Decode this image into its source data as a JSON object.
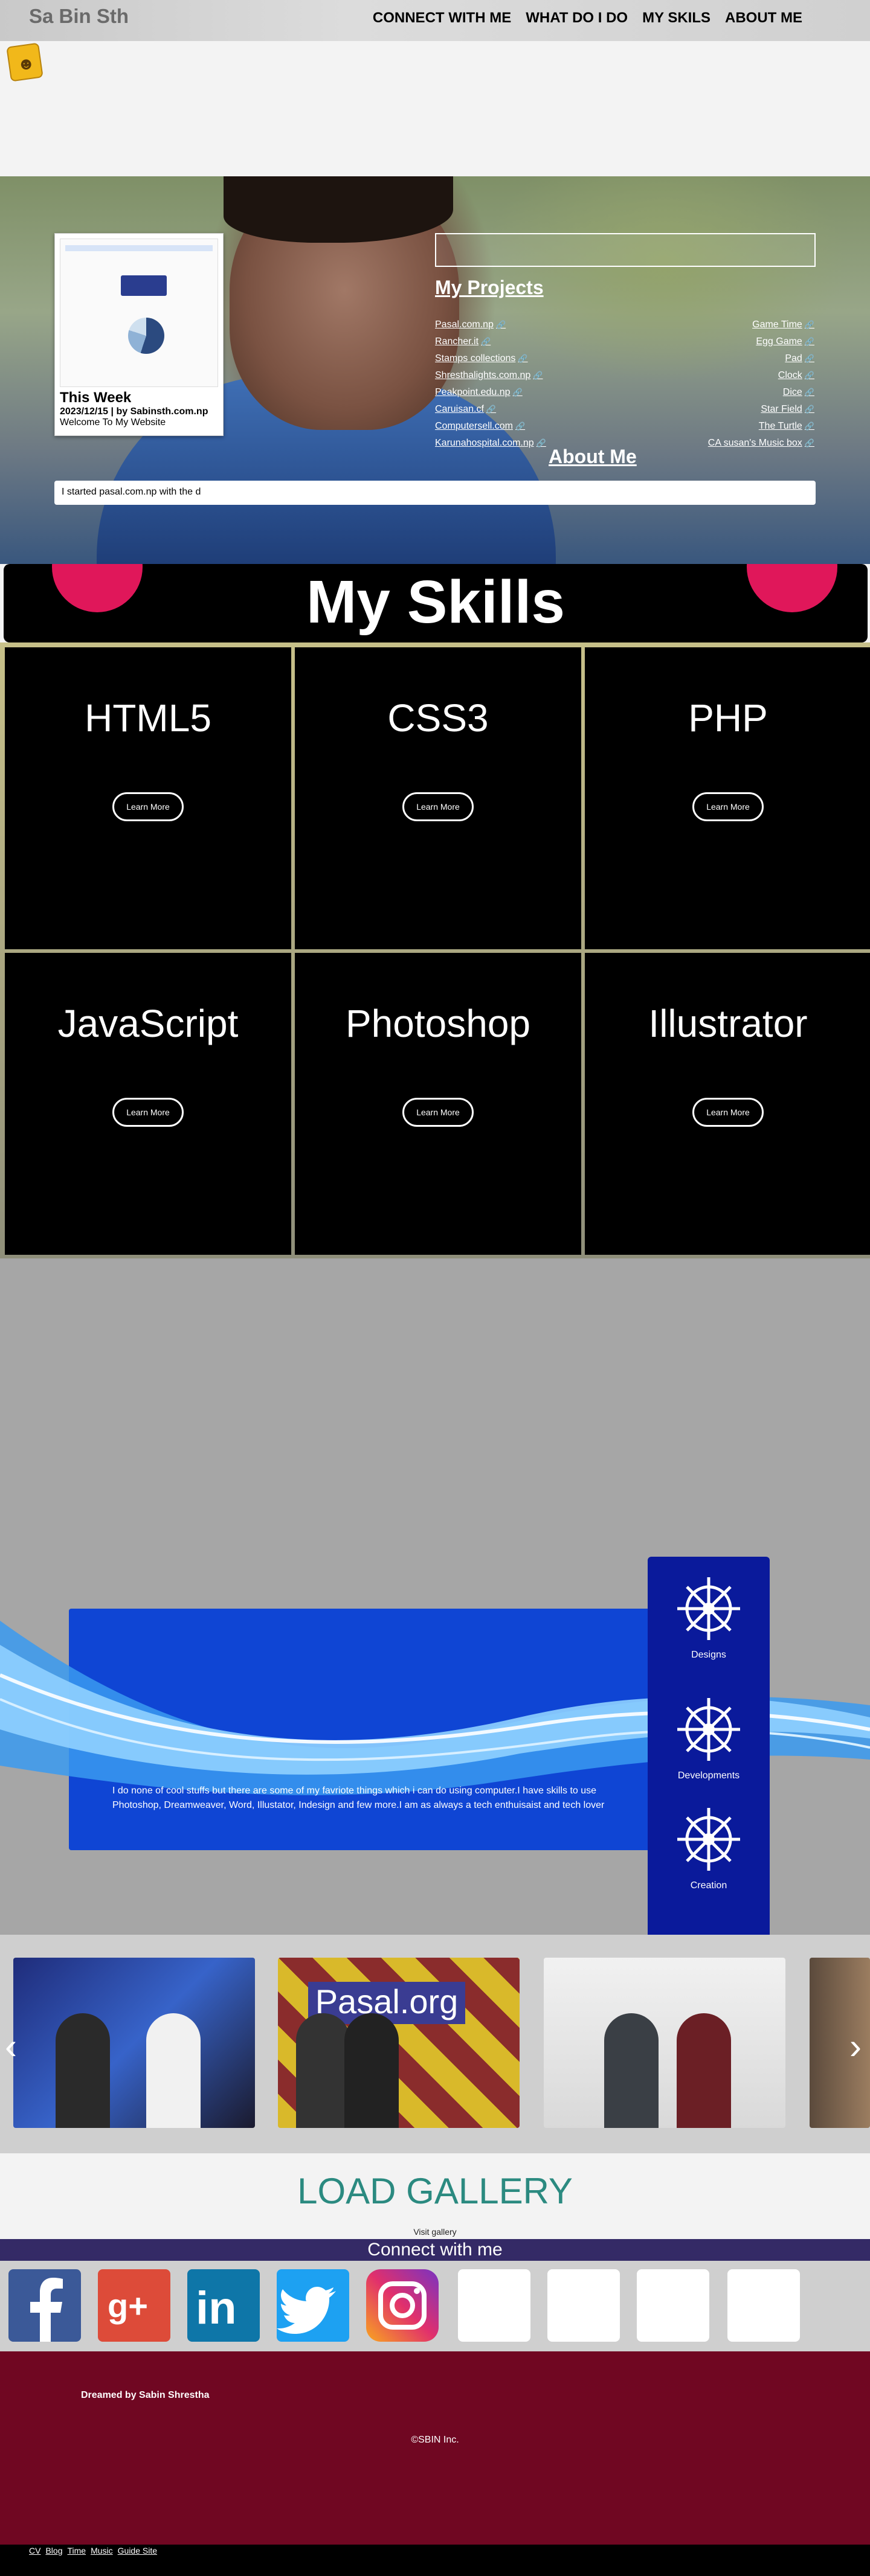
{
  "header": {
    "brand": "Sa Bin Sth",
    "nav": [
      "CONNECT WITH ME",
      "WHAT DO I DO",
      "MY SKILS",
      "ABOUT ME"
    ]
  },
  "week": {
    "title": "This Week",
    "meta": "2023/12/15 | by Sabinsth.com.np",
    "text": "Welcome To My Website"
  },
  "projects": {
    "title": "My Projects",
    "left": [
      "Pasal.com.np",
      "Rancher.it",
      "Stamps collections",
      "Shresthalights.com.np",
      "Peakpoint.edu.np",
      "Caruisan.cf",
      "Computersell.com",
      "Karunahospital.com.np"
    ],
    "right": [
      "Game Time",
      "Egg Game",
      "Pad",
      "Clock",
      "Dice",
      "Star Field",
      "The Turtle",
      "CA susan's Music box"
    ]
  },
  "about_title": "About Me",
  "ticker": "I started pasal.com.np with the d",
  "skills": {
    "title": "My Skills",
    "button_label": "Learn More",
    "items": [
      "HTML5",
      "CSS3",
      "PHP",
      "JavaScript",
      "Photoshop",
      "Illustrator"
    ]
  },
  "feature": {
    "text": "I do none of cool stuffs but there are some of my favriote things which i can do using computer.I have skills to use Photoshop, Dreamweaver, Word, Illustator, Indesign and few more.I am as always a tech enthuisaist and tech lover",
    "panel": [
      "Designs",
      "Developments",
      "Creation"
    ]
  },
  "gallery": {
    "banner": "Pasal.org",
    "load_title": "LOAD GALLERY",
    "visit": "Visit gallery"
  },
  "social": {
    "title": "Connect with me",
    "colors": {
      "facebook": "#3b5998",
      "googleplus": "#dd4b39",
      "linkedin": "#0e76a8",
      "twitter": "#1da1f2"
    }
  },
  "footer": {
    "dreamed": "Dreamed by Sabin Shrestha",
    "copyright": "©SBIN Inc.",
    "links": [
      "CV",
      "Blog",
      "Time",
      "Music",
      "Guide Site"
    ]
  }
}
